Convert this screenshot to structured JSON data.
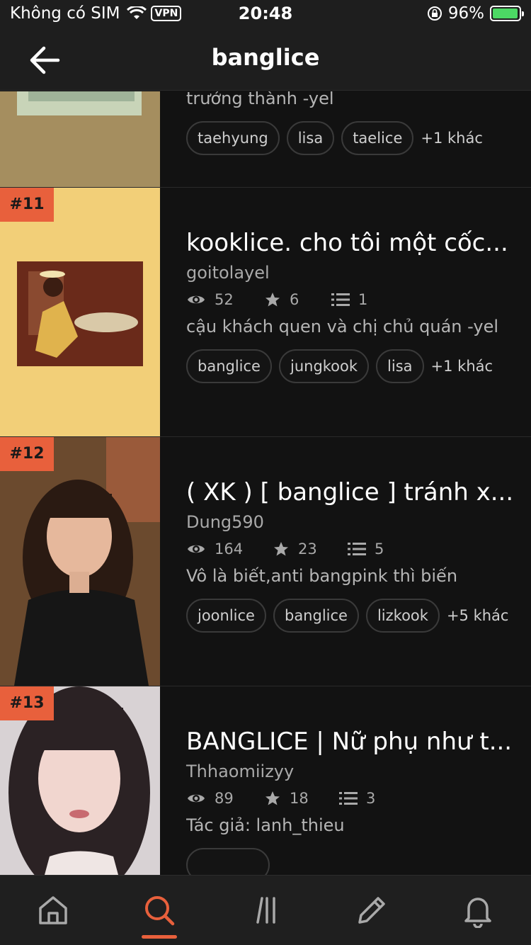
{
  "status_bar": {
    "carrier": "Không có SIM",
    "vpn": "VPN",
    "time": "20:48",
    "battery": "96%",
    "battery_level": 0.96
  },
  "nav": {
    "title": "banglice"
  },
  "stories": [
    {
      "rank": "",
      "title": "",
      "author": "",
      "views": "",
      "votes": "",
      "parts": "",
      "description": "trưởng thành -yel",
      "tags": [
        "taehyung",
        "lisa",
        "taelice"
      ],
      "more": "+1 khác"
    },
    {
      "rank": "#11",
      "title": "kooklice. cho tôi một cốc...",
      "author": "goitolayel",
      "views": "52",
      "votes": "6",
      "parts": "1",
      "description": "cậu khách quen và chị chủ quán  -yel",
      "tags": [
        "banglice",
        "jungkook",
        "lisa"
      ],
      "more": "+1 khác"
    },
    {
      "rank": "#12",
      "title": "( XK ) [ banglice ] tránh x...",
      "author": "Dung590",
      "views": "164",
      "votes": "23",
      "parts": "5",
      "description": "Vô là biết,anti bangpink thì biến",
      "tags": [
        "joonlice",
        "banglice",
        "lizkook"
      ],
      "more": "+5 khác"
    },
    {
      "rank": "#13",
      "title": "BANGLICE | Nữ phụ như t...",
      "author": "Thhaomiizyy",
      "views": "89",
      "votes": "18",
      "parts": "3",
      "description": "Tác giả: lanh_thieu",
      "tags": [],
      "more": ""
    }
  ],
  "tabs": [
    "home-icon",
    "search-icon",
    "library-icon",
    "write-icon",
    "notifications-icon"
  ],
  "colors": {
    "accent": "#e8603c",
    "background": "#121212",
    "bar": "#1e1e1e"
  }
}
